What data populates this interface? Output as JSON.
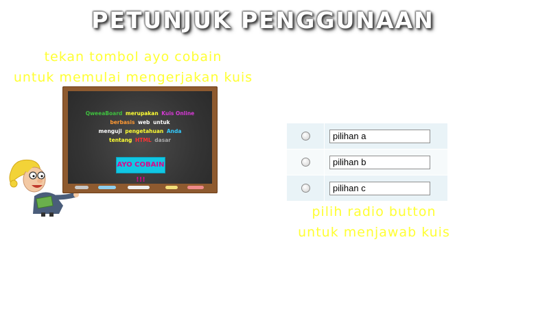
{
  "page": {
    "title": "PETUNJUK PENGGUNAAN"
  },
  "hints": {
    "start_line1": "tekan tombol ayo cobain",
    "start_line2": "untuk memulai mengerjakan kuis",
    "answer_line1": "pilih radio button",
    "answer_line2": "untuk menjawab kuis"
  },
  "board": {
    "line1": [
      {
        "text": "QweeaBoard",
        "color": "#3fbf3f"
      },
      {
        "text": "merupakan",
        "color": "#ffff33"
      },
      {
        "text": "Kuis Online",
        "color": "#d63ad6"
      }
    ],
    "line2": [
      {
        "text": "berbasis",
        "color": "#ff9933"
      },
      {
        "text": "web",
        "color": "#ffffff"
      },
      {
        "text": "untuk",
        "color": "#ffffff"
      }
    ],
    "line3": [
      {
        "text": "menguji",
        "color": "#ffffff"
      },
      {
        "text": "pengetahuan",
        "color": "#ffff33"
      },
      {
        "text": "Anda",
        "color": "#33ccff"
      }
    ],
    "line4": [
      {
        "text": "tentang",
        "color": "#ffff33"
      },
      {
        "text": "HTML",
        "color": "#ff3333"
      },
      {
        "text": "dasar",
        "color": "#aaaaaa"
      }
    ],
    "button_label": "AYO COBAIN !!!",
    "colors": {
      "frame": "#8e5a2f",
      "surface": "#3a3a3a",
      "button_bg": "#11c7e3",
      "button_text": "#d60a8a"
    }
  },
  "options": [
    {
      "value": "pilihan a"
    },
    {
      "value": "pilihan b"
    },
    {
      "value": "pilihan c"
    }
  ],
  "colors": {
    "hint_text": "#ffff33",
    "title_text": "#ffffff"
  }
}
